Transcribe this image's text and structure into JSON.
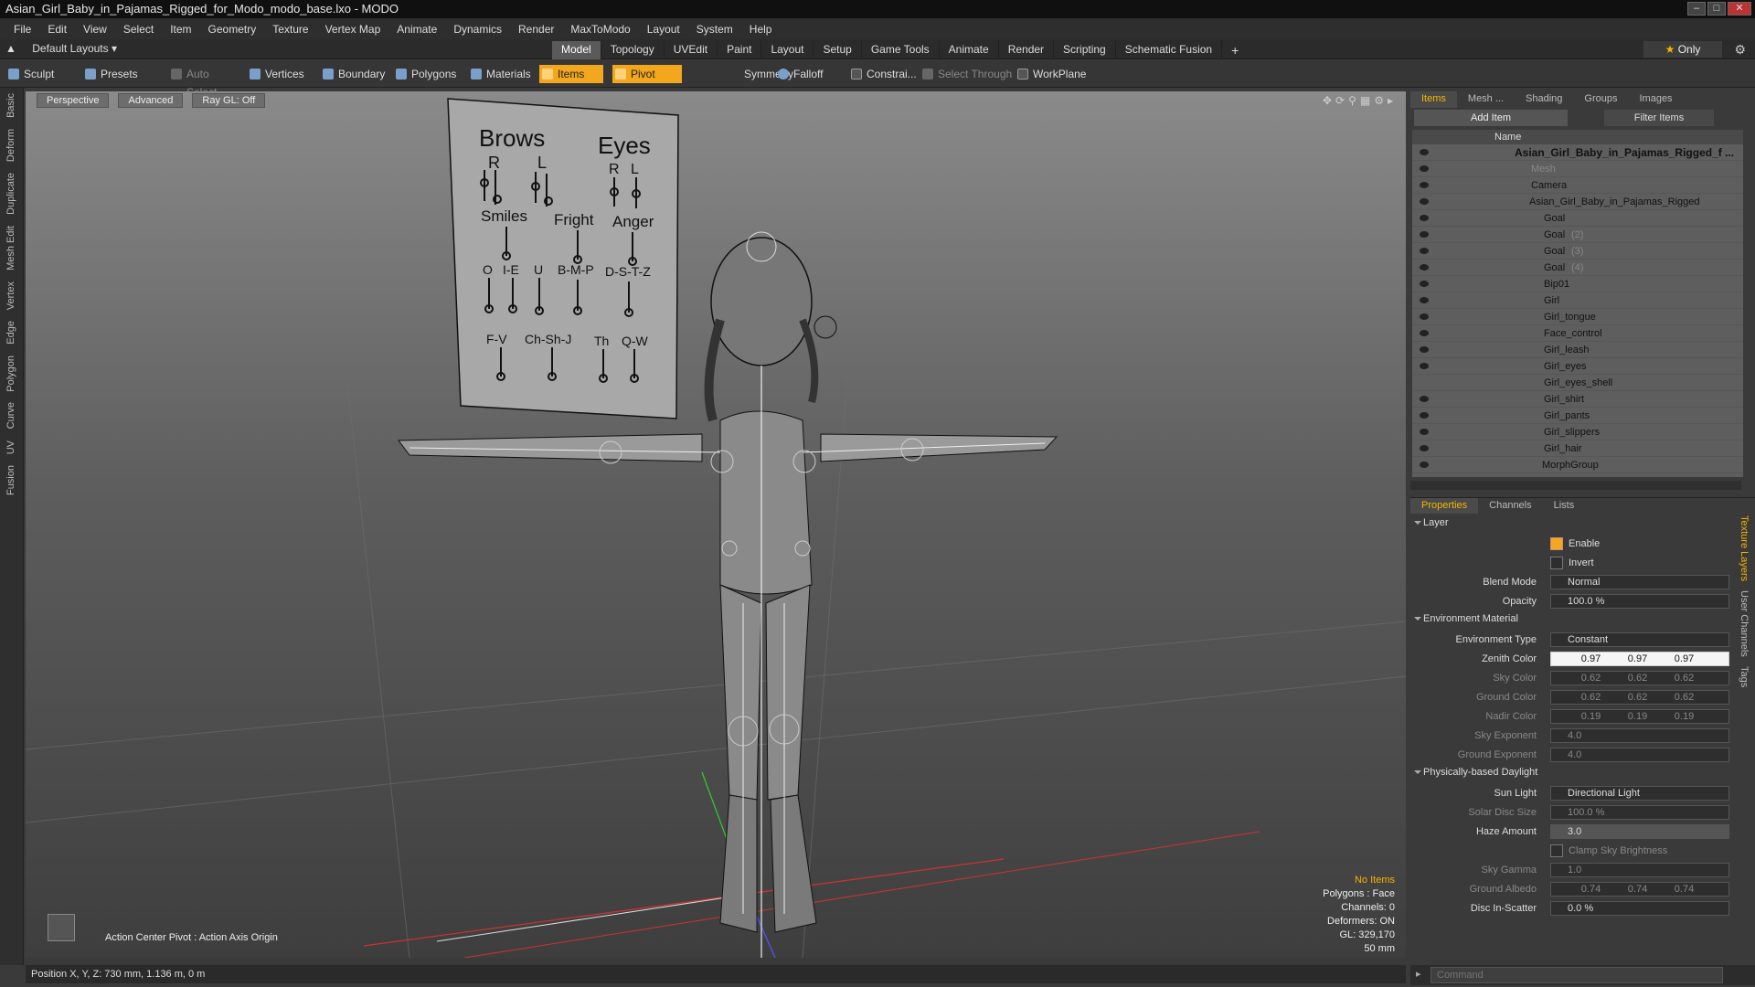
{
  "window": {
    "title": "Asian_Girl_Baby_in_Pajamas_Rigged_for_Modo_modo_base.lxo - MODO"
  },
  "menu": [
    "File",
    "Edit",
    "View",
    "Select",
    "Item",
    "Geometry",
    "Texture",
    "Vertex Map",
    "Animate",
    "Dynamics",
    "Render",
    "MaxToModo",
    "Layout",
    "System",
    "Help"
  ],
  "layout": {
    "selector": "Default Layouts",
    "tabs": [
      "Model",
      "Topology",
      "UVEdit",
      "Paint",
      "Layout",
      "Setup",
      "Game Tools",
      "Animate",
      "Render",
      "Scripting",
      "Schematic Fusion"
    ],
    "active_tab": "Model",
    "only_label": "Only"
  },
  "toolbar": {
    "sculpt": "Sculpt",
    "presets": "Presets",
    "auto_select": "Auto Select",
    "vertices": "Vertices",
    "boundary": "Boundary",
    "polygons": "Polygons",
    "materials": "Materials",
    "items": "Items",
    "pivot": "Pivot",
    "symmetry": "Symmetry",
    "falloff": "Falloff",
    "constraints": "Constrai...",
    "select_through": "Select Through",
    "workplane": "WorkPlane"
  },
  "left_tabs": [
    "Basic",
    "Deform",
    "Duplicate",
    "Mesh Edit",
    "Vertex",
    "Edge",
    "Polygon",
    "Curve",
    "UV",
    "Fusion"
  ],
  "viewport": {
    "perspective": "Perspective",
    "advanced": "Advanced",
    "raygl": "Ray GL: Off",
    "action_center": "Action Center Pivot : Action Axis Origin",
    "info": {
      "no_items": "No Items",
      "polygons": "Polygons : Face",
      "channels": "Channels: 0",
      "deformers": "Deformers: ON",
      "gl": "GL: 329,170",
      "lens": "50 mm"
    },
    "board": {
      "brows": "Brows",
      "eyes": "Eyes",
      "r1": "R",
      "l1": "L",
      "r2": "R",
      "l2": "L",
      "smiles": "Smiles",
      "fright": "Fright",
      "anger": "Anger",
      "o": "O",
      "ie": "I-E",
      "u": "U",
      "bmp": "B-M-P",
      "dstz": "D-S-T-Z",
      "fv": "F-V",
      "chshj": "Ch-Sh-J",
      "th": "Th",
      "qw": "Q-W"
    }
  },
  "status": {
    "position": "Position X, Y, Z:   730 mm, 1.136 m, 0 m"
  },
  "items_panel": {
    "tabs": [
      "Items",
      "Mesh ...",
      "Shading",
      "Groups",
      "Images"
    ],
    "active_tab": "Items",
    "add_item": "Add Item",
    "filter": "Filter Items",
    "name_header": "Name",
    "rows": [
      {
        "label": "Asian_Girl_Baby_in_Pajamas_Rigged_f ...",
        "suffix": ""
      },
      {
        "label": "Mesh",
        "suffix": ""
      },
      {
        "label": "Camera",
        "suffix": ""
      },
      {
        "label": "Asian_Girl_Baby_in_Pajamas_Rigged",
        "suffix": ""
      },
      {
        "label": "Goal",
        "suffix": ""
      },
      {
        "label": "Goal",
        "suffix": "(2)"
      },
      {
        "label": "Goal",
        "suffix": "(3)"
      },
      {
        "label": "Goal",
        "suffix": "(4)"
      },
      {
        "label": "Bip01",
        "suffix": ""
      },
      {
        "label": "Girl",
        "suffix": ""
      },
      {
        "label": "Girl_tongue",
        "suffix": ""
      },
      {
        "label": "Face_control",
        "suffix": ""
      },
      {
        "label": "Girl_leash",
        "suffix": ""
      },
      {
        "label": "Girl_eyes",
        "suffix": ""
      },
      {
        "label": "Girl_eyes_shell",
        "suffix": ""
      },
      {
        "label": "Girl_shirt",
        "suffix": ""
      },
      {
        "label": "Girl_pants",
        "suffix": ""
      },
      {
        "label": "Girl_slippers",
        "suffix": ""
      },
      {
        "label": "Girl_hair",
        "suffix": ""
      },
      {
        "label": "MorphGroup",
        "suffix": ""
      }
    ]
  },
  "properties": {
    "tabs": [
      "Properties",
      "Channels",
      "Lists"
    ],
    "active_tab": "Properties",
    "side_tabs": [
      "Texture Layers",
      "User Channels",
      "Tags"
    ],
    "layer_section": "Layer",
    "enable": "Enable",
    "invert": "Invert",
    "blend_mode": {
      "label": "Blend Mode",
      "value": "Normal"
    },
    "opacity": {
      "label": "Opacity",
      "value": "100.0 %"
    },
    "env_section": "Environment Material",
    "env_type": {
      "label": "Environment Type",
      "value": "Constant"
    },
    "zenith": {
      "label": "Zenith Color",
      "r": "0.97",
      "g": "0.97",
      "b": "0.97"
    },
    "sky": {
      "label": "Sky Color",
      "r": "0.62",
      "g": "0.62",
      "b": "0.62"
    },
    "ground": {
      "label": "Ground Color",
      "r": "0.62",
      "g": "0.62",
      "b": "0.62"
    },
    "nadir": {
      "label": "Nadir Color",
      "r": "0.19",
      "g": "0.19",
      "b": "0.19"
    },
    "sky_exp": {
      "label": "Sky Exponent",
      "value": "4.0"
    },
    "ground_exp": {
      "label": "Ground Exponent",
      "value": "4.0"
    },
    "daylight_section": "Physically-based Daylight",
    "sun_light": {
      "label": "Sun Light",
      "value": "Directional Light"
    },
    "solar_disc": {
      "label": "Solar Disc Size",
      "value": "100.0 %"
    },
    "haze": {
      "label": "Haze Amount",
      "value": "3.0"
    },
    "clamp": "Clamp Sky Brightness",
    "sky_gamma": {
      "label": "Sky Gamma",
      "value": "1.0"
    },
    "albedo": {
      "label": "Ground Albedo",
      "r": "0.74",
      "g": "0.74",
      "b": "0.74"
    },
    "disc_scatter": {
      "label": "Disc In-Scatter",
      "value": "0.0 %"
    }
  },
  "command": {
    "placeholder": "Command"
  }
}
